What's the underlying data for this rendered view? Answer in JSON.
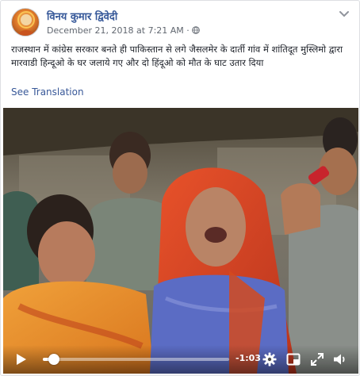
{
  "post": {
    "author": "विनय कुमार द्विवेदी",
    "timestamp": "December 21, 2018 at 7:21 AM",
    "text": "राजस्थान में कांग्रेस सरकार बनते ही पाकिस्तान से लगे जैसलमेर के दार्ती गांव में शांतिदूत मुस्लिमो द्वारा मारवाडी हिन्दूओ के घर जलाये गए और दो हिंदूओ को मौत के घाट उतार दिया",
    "see_translation": "See Translation"
  },
  "icons": {
    "avatar": "avatar-image",
    "menu": "chevron-down-icon",
    "privacy": "globe-icon"
  },
  "video": {
    "progress": 0.06,
    "remaining_time": "-1:03",
    "controls": [
      "play-icon",
      "gear-icon",
      "picture-in-picture-icon",
      "expand-icon",
      "volume-icon"
    ]
  },
  "colors": {
    "link": "#385898",
    "author": "#365899",
    "meta": "#616770"
  }
}
